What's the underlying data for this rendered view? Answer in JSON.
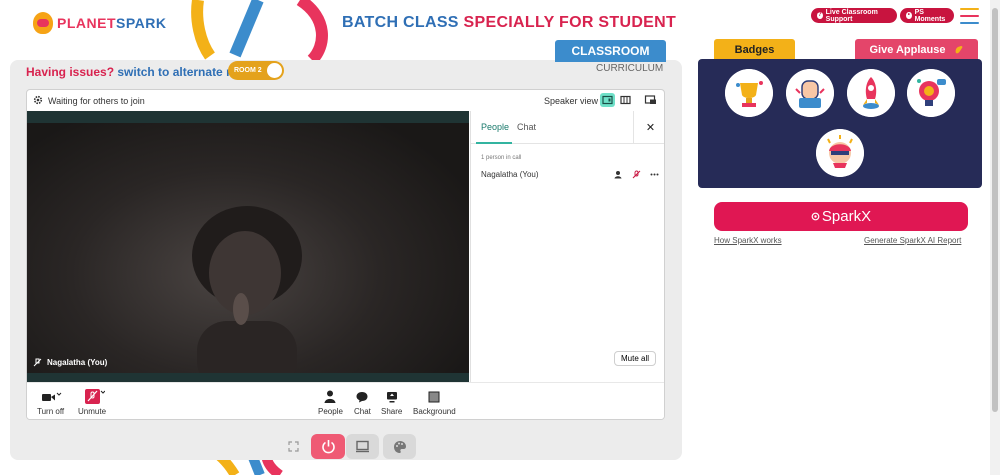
{
  "header": {
    "logo_part1": "PLANET",
    "logo_part2": "SPARK",
    "headline_part1": "BATCH CLASS",
    "headline_part2": "SPECIALLY FOR STUDENT",
    "live_support_label": "Live Classroom Support",
    "ps_moments_label": "PS Moments"
  },
  "tabs": {
    "classroom": "CLASSROOM",
    "curriculum": "CURRICULUM"
  },
  "issue": {
    "text1": "Having issues?",
    "text2": "switch to alternate room",
    "room_label": "ROOM 2"
  },
  "meet": {
    "waiting_text": "Waiting for others to join",
    "speaker_view_label": "Speaker view",
    "participant_name": "Nagalatha (You)",
    "side_tabs": [
      "People",
      "Chat"
    ],
    "close_symbol": "✕",
    "people_count": "1 person in call",
    "person_row_name": "Nagalatha (You)",
    "mute_all_label": "Mute all",
    "controls": {
      "turn_off": "Turn off",
      "unmute": "Unmute",
      "people": "People",
      "chat": "Chat",
      "share": "Share",
      "background": "Background"
    }
  },
  "right": {
    "badges_label": "Badges",
    "applause_label": "Give Applause",
    "sparkx_label": "SparkX",
    "how_link": "How SparkX works",
    "report_link": "Generate SparkX AI Report"
  },
  "colors": {
    "brand_red": "#d8234f",
    "brand_blue": "#2f6fb5",
    "brand_yellow": "#f3b118",
    "navy": "#262b57",
    "accent_teal": "#32b4a0"
  }
}
